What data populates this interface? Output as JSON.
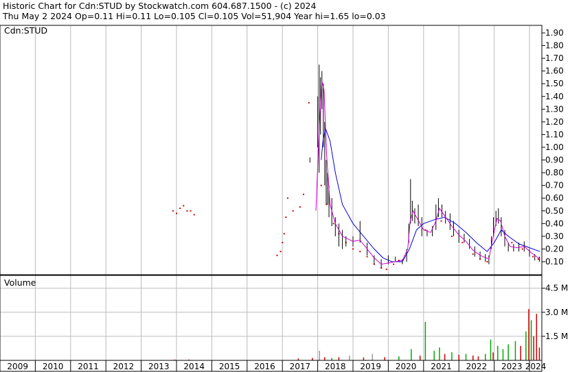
{
  "header": {
    "title": "Historic Chart for Cdn:STUD by Stockwatch.com 604.687.1500 - (c) 2024",
    "quote": "Thu May  2 2024  Op=0.11  Hi=0.11  Lo=0.105  Cl=0.105  Vol=51,904  Year hi=1.65  lo=0.03"
  },
  "chart_data": {
    "type": "line",
    "symbol_label": "Cdn:STUD",
    "volume_label": "Volume",
    "price_ticks": [
      "1.90",
      "1.80",
      "1.70",
      "1.60",
      "1.50",
      "1.40",
      "1.30",
      "1.20",
      "1.10",
      "1.00",
      "0.90",
      "0.80",
      "0.70",
      "0.60",
      "0.50",
      "0.40",
      "0.30",
      "0.20",
      "0.10"
    ],
    "price_ylim": [
      0,
      1.95
    ],
    "volume_ticks": [
      "4.5 M",
      "3.0 M",
      "1.5 M"
    ],
    "volume_ylim": [
      0,
      5300000
    ],
    "years": [
      "2009",
      "2010",
      "2011",
      "2012",
      "2013",
      "2014",
      "2015",
      "2016",
      "2017",
      "2018",
      "2019",
      "2020",
      "2021",
      "2022",
      "2023",
      "2024"
    ],
    "colors": {
      "price": "#000000",
      "dots": "#cc0000",
      "ma_fast": "#cc00cc",
      "ma_slow": "#0000cc",
      "vol_up": "#00aa00",
      "vol_down": "#cc0000",
      "vol_flat": "#999999"
    },
    "grid": true,
    "dots": [
      {
        "x": 2013.9,
        "y": 0.5
      },
      {
        "x": 2014.0,
        "y": 0.48
      },
      {
        "x": 2014.1,
        "y": 0.52
      },
      {
        "x": 2014.2,
        "y": 0.54
      },
      {
        "x": 2014.3,
        "y": 0.5
      },
      {
        "x": 2014.4,
        "y": 0.5
      },
      {
        "x": 2014.5,
        "y": 0.47
      },
      {
        "x": 2016.85,
        "y": 0.15
      },
      {
        "x": 2016.95,
        "y": 0.18
      },
      {
        "x": 2017.0,
        "y": 0.25
      },
      {
        "x": 2017.05,
        "y": 0.32
      },
      {
        "x": 2017.1,
        "y": 0.45
      },
      {
        "x": 2017.15,
        "y": 0.6
      },
      {
        "x": 2017.3,
        "y": 0.5
      },
      {
        "x": 2017.5,
        "y": 0.53
      },
      {
        "x": 2017.6,
        "y": 0.63
      },
      {
        "x": 2017.75,
        "y": 1.35
      },
      {
        "x": 2018.1,
        "y": 0.7
      },
      {
        "x": 2018.25,
        "y": 0.55
      },
      {
        "x": 2018.45,
        "y": 0.4
      },
      {
        "x": 2018.6,
        "y": 0.32
      },
      {
        "x": 2018.8,
        "y": 0.25
      },
      {
        "x": 2019.0,
        "y": 0.2
      },
      {
        "x": 2019.2,
        "y": 0.18
      },
      {
        "x": 2019.4,
        "y": 0.14
      },
      {
        "x": 2019.6,
        "y": 0.08
      },
      {
        "x": 2019.8,
        "y": 0.05
      },
      {
        "x": 2019.95,
        "y": 0.04
      },
      {
        "x": 2020.15,
        "y": 0.08
      },
      {
        "x": 2020.3,
        "y": 0.11
      },
      {
        "x": 2021.05,
        "y": 0.35
      },
      {
        "x": 2021.5,
        "y": 0.42
      },
      {
        "x": 2021.8,
        "y": 0.3
      },
      {
        "x": 2022.1,
        "y": 0.25
      },
      {
        "x": 2022.4,
        "y": 0.16
      },
      {
        "x": 2022.6,
        "y": 0.12
      },
      {
        "x": 2022.8,
        "y": 0.1
      },
      {
        "x": 2023.5,
        "y": 0.25
      },
      {
        "x": 2023.8,
        "y": 0.2
      },
      {
        "x": 2024.1,
        "y": 0.14
      },
      {
        "x": 2024.25,
        "y": 0.12
      }
    ],
    "price_bars": [
      {
        "x": 2017.78,
        "hi": 0.92,
        "lo": 0.88
      },
      {
        "x": 2018.0,
        "hi": 1.4,
        "lo": 1.0
      },
      {
        "x": 2018.04,
        "hi": 1.65,
        "lo": 0.8
      },
      {
        "x": 2018.08,
        "hi": 1.55,
        "lo": 1.1
      },
      {
        "x": 2018.12,
        "hi": 1.6,
        "lo": 1.3
      },
      {
        "x": 2018.16,
        "hi": 1.5,
        "lo": 1.0
      },
      {
        "x": 2018.2,
        "hi": 1.2,
        "lo": 0.7
      },
      {
        "x": 2018.24,
        "hi": 0.9,
        "lo": 0.55
      },
      {
        "x": 2018.28,
        "hi": 0.8,
        "lo": 0.55
      },
      {
        "x": 2018.32,
        "hi": 0.7,
        "lo": 0.45
      },
      {
        "x": 2018.4,
        "hi": 0.6,
        "lo": 0.38
      },
      {
        "x": 2018.5,
        "hi": 0.45,
        "lo": 0.3
      },
      {
        "x": 2018.6,
        "hi": 0.4,
        "lo": 0.22
      },
      {
        "x": 2018.7,
        "hi": 0.35,
        "lo": 0.2
      },
      {
        "x": 2018.8,
        "hi": 0.3,
        "lo": 0.22
      },
      {
        "x": 2019.0,
        "hi": 0.3,
        "lo": 0.22
      },
      {
        "x": 2019.2,
        "hi": 0.42,
        "lo": 0.25
      },
      {
        "x": 2019.4,
        "hi": 0.25,
        "lo": 0.15
      },
      {
        "x": 2019.6,
        "hi": 0.15,
        "lo": 0.08
      },
      {
        "x": 2019.8,
        "hi": 0.12,
        "lo": 0.05
      },
      {
        "x": 2020.0,
        "hi": 0.15,
        "lo": 0.08
      },
      {
        "x": 2020.2,
        "hi": 0.14,
        "lo": 0.1
      },
      {
        "x": 2020.4,
        "hi": 0.12,
        "lo": 0.08
      },
      {
        "x": 2020.52,
        "hi": 0.2,
        "lo": 0.1
      },
      {
        "x": 2020.58,
        "hi": 0.4,
        "lo": 0.25
      },
      {
        "x": 2020.63,
        "hi": 0.75,
        "lo": 0.4
      },
      {
        "x": 2020.68,
        "hi": 0.58,
        "lo": 0.42
      },
      {
        "x": 2020.75,
        "hi": 0.52,
        "lo": 0.4
      },
      {
        "x": 2020.85,
        "hi": 0.55,
        "lo": 0.38
      },
      {
        "x": 2020.95,
        "hi": 0.45,
        "lo": 0.3
      },
      {
        "x": 2021.1,
        "hi": 0.35,
        "lo": 0.3
      },
      {
        "x": 2021.25,
        "hi": 0.38,
        "lo": 0.3
      },
      {
        "x": 2021.35,
        "hi": 0.55,
        "lo": 0.35
      },
      {
        "x": 2021.42,
        "hi": 0.6,
        "lo": 0.45
      },
      {
        "x": 2021.52,
        "hi": 0.55,
        "lo": 0.45
      },
      {
        "x": 2021.62,
        "hi": 0.5,
        "lo": 0.4
      },
      {
        "x": 2021.75,
        "hi": 0.48,
        "lo": 0.35
      },
      {
        "x": 2021.85,
        "hi": 0.42,
        "lo": 0.3
      },
      {
        "x": 2022.0,
        "hi": 0.35,
        "lo": 0.25
      },
      {
        "x": 2022.15,
        "hi": 0.32,
        "lo": 0.25
      },
      {
        "x": 2022.3,
        "hi": 0.28,
        "lo": 0.2
      },
      {
        "x": 2022.45,
        "hi": 0.22,
        "lo": 0.14
      },
      {
        "x": 2022.6,
        "hi": 0.18,
        "lo": 0.12
      },
      {
        "x": 2022.75,
        "hi": 0.16,
        "lo": 0.1
      },
      {
        "x": 2022.85,
        "hi": 0.15,
        "lo": 0.08
      },
      {
        "x": 2022.92,
        "hi": 0.3,
        "lo": 0.2
      },
      {
        "x": 2022.98,
        "hi": 0.45,
        "lo": 0.3
      },
      {
        "x": 2023.05,
        "hi": 0.5,
        "lo": 0.38
      },
      {
        "x": 2023.12,
        "hi": 0.52,
        "lo": 0.4
      },
      {
        "x": 2023.2,
        "hi": 0.45,
        "lo": 0.3
      },
      {
        "x": 2023.3,
        "hi": 0.35,
        "lo": 0.22
      },
      {
        "x": 2023.4,
        "hi": 0.25,
        "lo": 0.18
      },
      {
        "x": 2023.55,
        "hi": 0.24,
        "lo": 0.18
      },
      {
        "x": 2023.7,
        "hi": 0.25,
        "lo": 0.18
      },
      {
        "x": 2023.85,
        "hi": 0.26,
        "lo": 0.18
      },
      {
        "x": 2024.0,
        "hi": 0.2,
        "lo": 0.14
      },
      {
        "x": 2024.15,
        "hi": 0.16,
        "lo": 0.11
      },
      {
        "x": 2024.28,
        "hi": 0.14,
        "lo": 0.1
      }
    ],
    "ma_fast": [
      {
        "x": 2017.95,
        "y": 0.5
      },
      {
        "x": 2018.05,
        "y": 1.2
      },
      {
        "x": 2018.12,
        "y": 1.52
      },
      {
        "x": 2018.18,
        "y": 1.45
      },
      {
        "x": 2018.25,
        "y": 0.95
      },
      {
        "x": 2018.35,
        "y": 0.55
      },
      {
        "x": 2018.5,
        "y": 0.4
      },
      {
        "x": 2018.7,
        "y": 0.3
      },
      {
        "x": 2019.0,
        "y": 0.26
      },
      {
        "x": 2019.2,
        "y": 0.27
      },
      {
        "x": 2019.4,
        "y": 0.2
      },
      {
        "x": 2019.6,
        "y": 0.13
      },
      {
        "x": 2019.8,
        "y": 0.08
      },
      {
        "x": 2020.0,
        "y": 0.09
      },
      {
        "x": 2020.2,
        "y": 0.1
      },
      {
        "x": 2020.4,
        "y": 0.11
      },
      {
        "x": 2020.55,
        "y": 0.2
      },
      {
        "x": 2020.62,
        "y": 0.42
      },
      {
        "x": 2020.7,
        "y": 0.5
      },
      {
        "x": 2020.8,
        "y": 0.45
      },
      {
        "x": 2021.0,
        "y": 0.35
      },
      {
        "x": 2021.2,
        "y": 0.33
      },
      {
        "x": 2021.35,
        "y": 0.42
      },
      {
        "x": 2021.45,
        "y": 0.52
      },
      {
        "x": 2021.6,
        "y": 0.46
      },
      {
        "x": 2021.8,
        "y": 0.38
      },
      {
        "x": 2022.0,
        "y": 0.31
      },
      {
        "x": 2022.2,
        "y": 0.26
      },
      {
        "x": 2022.4,
        "y": 0.19
      },
      {
        "x": 2022.6,
        "y": 0.15
      },
      {
        "x": 2022.85,
        "y": 0.12
      },
      {
        "x": 2022.95,
        "y": 0.27
      },
      {
        "x": 2023.08,
        "y": 0.44
      },
      {
        "x": 2023.18,
        "y": 0.42
      },
      {
        "x": 2023.3,
        "y": 0.3
      },
      {
        "x": 2023.45,
        "y": 0.22
      },
      {
        "x": 2023.65,
        "y": 0.21
      },
      {
        "x": 2023.85,
        "y": 0.22
      },
      {
        "x": 2024.05,
        "y": 0.17
      },
      {
        "x": 2024.3,
        "y": 0.12
      }
    ],
    "ma_slow": [
      {
        "x": 2018.1,
        "y": 0.9
      },
      {
        "x": 2018.15,
        "y": 1.05
      },
      {
        "x": 2018.22,
        "y": 1.15
      },
      {
        "x": 2018.35,
        "y": 1.05
      },
      {
        "x": 2018.5,
        "y": 0.8
      },
      {
        "x": 2018.7,
        "y": 0.55
      },
      {
        "x": 2019.0,
        "y": 0.4
      },
      {
        "x": 2019.3,
        "y": 0.3
      },
      {
        "x": 2019.6,
        "y": 0.2
      },
      {
        "x": 2019.85,
        "y": 0.13
      },
      {
        "x": 2020.1,
        "y": 0.1
      },
      {
        "x": 2020.4,
        "y": 0.1
      },
      {
        "x": 2020.6,
        "y": 0.2
      },
      {
        "x": 2020.8,
        "y": 0.35
      },
      {
        "x": 2021.0,
        "y": 0.4
      },
      {
        "x": 2021.3,
        "y": 0.43
      },
      {
        "x": 2021.6,
        "y": 0.45
      },
      {
        "x": 2021.9,
        "y": 0.4
      },
      {
        "x": 2022.2,
        "y": 0.33
      },
      {
        "x": 2022.5,
        "y": 0.25
      },
      {
        "x": 2022.8,
        "y": 0.18
      },
      {
        "x": 2023.0,
        "y": 0.25
      },
      {
        "x": 2023.2,
        "y": 0.35
      },
      {
        "x": 2023.4,
        "y": 0.3
      },
      {
        "x": 2023.7,
        "y": 0.24
      },
      {
        "x": 2024.0,
        "y": 0.21
      },
      {
        "x": 2024.3,
        "y": 0.18
      }
    ],
    "volume": [
      {
        "x": 2013.95,
        "v": 50000,
        "c": "vol_down"
      },
      {
        "x": 2014.35,
        "v": 50000,
        "c": "vol_down"
      },
      {
        "x": 2017.45,
        "v": 120000,
        "c": "vol_down"
      },
      {
        "x": 2017.85,
        "v": 150000,
        "c": "vol_down"
      },
      {
        "x": 2018.05,
        "v": 600000,
        "c": "vol_flat"
      },
      {
        "x": 2018.2,
        "v": 200000,
        "c": "vol_down"
      },
      {
        "x": 2018.4,
        "v": 150000,
        "c": "vol_up"
      },
      {
        "x": 2018.6,
        "v": 200000,
        "c": "vol_down"
      },
      {
        "x": 2018.9,
        "v": 300000,
        "c": "vol_flat"
      },
      {
        "x": 2019.3,
        "v": 180000,
        "c": "vol_down"
      },
      {
        "x": 2019.55,
        "v": 400000,
        "c": "vol_flat"
      },
      {
        "x": 2019.9,
        "v": 200000,
        "c": "vol_down"
      },
      {
        "x": 2020.3,
        "v": 250000,
        "c": "vol_up"
      },
      {
        "x": 2020.65,
        "v": 700000,
        "c": "vol_up"
      },
      {
        "x": 2020.9,
        "v": 300000,
        "c": "vol_down"
      },
      {
        "x": 2021.05,
        "v": 2400000,
        "c": "vol_up"
      },
      {
        "x": 2021.3,
        "v": 600000,
        "c": "vol_up"
      },
      {
        "x": 2021.45,
        "v": 800000,
        "c": "vol_up"
      },
      {
        "x": 2021.6,
        "v": 400000,
        "c": "vol_down"
      },
      {
        "x": 2021.8,
        "v": 500000,
        "c": "vol_up"
      },
      {
        "x": 2022.0,
        "v": 350000,
        "c": "vol_down"
      },
      {
        "x": 2022.2,
        "v": 400000,
        "c": "vol_up"
      },
      {
        "x": 2022.4,
        "v": 300000,
        "c": "vol_down"
      },
      {
        "x": 2022.55,
        "v": 250000,
        "c": "vol_down"
      },
      {
        "x": 2022.75,
        "v": 400000,
        "c": "vol_up"
      },
      {
        "x": 2022.9,
        "v": 1300000,
        "c": "vol_up"
      },
      {
        "x": 2022.97,
        "v": 500000,
        "c": "vol_down"
      },
      {
        "x": 2023.1,
        "v": 900000,
        "c": "vol_up"
      },
      {
        "x": 2023.25,
        "v": 700000,
        "c": "vol_up"
      },
      {
        "x": 2023.4,
        "v": 1000000,
        "c": "vol_up"
      },
      {
        "x": 2023.6,
        "v": 1200000,
        "c": "vol_up"
      },
      {
        "x": 2023.75,
        "v": 900000,
        "c": "vol_down"
      },
      {
        "x": 2023.9,
        "v": 1800000,
        "c": "vol_up"
      },
      {
        "x": 2023.98,
        "v": 3200000,
        "c": "vol_down"
      },
      {
        "x": 2024.05,
        "v": 2500000,
        "c": "vol_up"
      },
      {
        "x": 2024.12,
        "v": 1500000,
        "c": "vol_down"
      },
      {
        "x": 2024.2,
        "v": 2900000,
        "c": "vol_down"
      },
      {
        "x": 2024.28,
        "v": 800000,
        "c": "vol_down"
      }
    ]
  }
}
